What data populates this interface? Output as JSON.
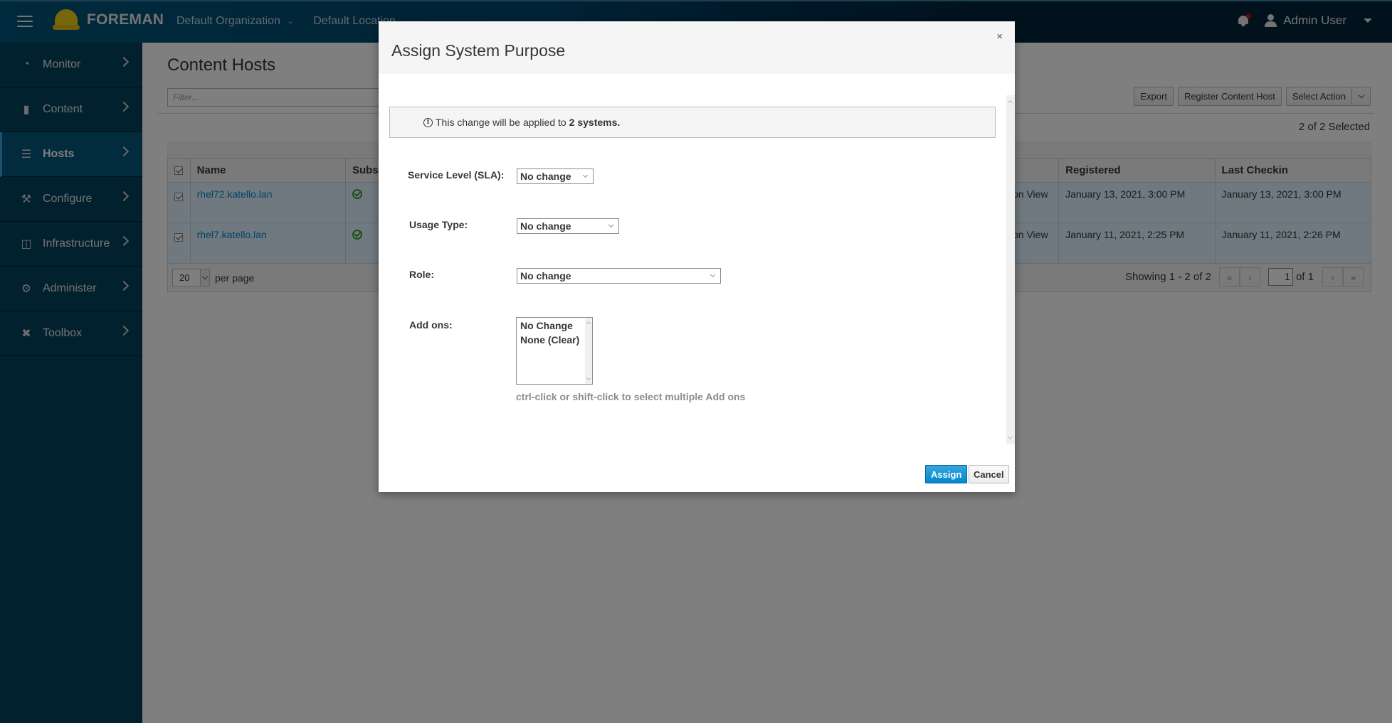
{
  "topbar": {
    "brand": "FOREMAN",
    "organization": "Default Organization",
    "location": "Default Location",
    "user": "Admin User",
    "icons": {
      "menu": "hamburger-icon",
      "logo": "helmet-icon",
      "notifications": "bell-icon",
      "user": "user-icon"
    }
  },
  "sidebar": {
    "items": [
      {
        "label": "Monitor",
        "icon": "dashboard-icon",
        "active": false
      },
      {
        "label": "Content",
        "icon": "book-icon",
        "active": false
      },
      {
        "label": "Hosts",
        "icon": "server-icon",
        "active": true
      },
      {
        "label": "Configure",
        "icon": "wrench-icon",
        "active": false
      },
      {
        "label": "Infrastructure",
        "icon": "network-icon",
        "active": false
      },
      {
        "label": "Administer",
        "icon": "gear-icon",
        "active": false
      },
      {
        "label": "Toolbox",
        "icon": "tools-icon",
        "active": false
      }
    ]
  },
  "main": {
    "title": "Content Hosts",
    "filter_placeholder": "Filter...",
    "actions": {
      "export": "Export",
      "register": "Register Content Host",
      "select_action": "Select Action"
    },
    "selected_count": "2 of 2 Selected",
    "table": {
      "columns": [
        "Name",
        "Subscri",
        "",
        "Registered",
        "Last Checkin"
      ],
      "rows": [
        {
          "name": "rhel72.katello.lan",
          "subscription_ok": true,
          "content_view_partial": "on View",
          "registered": "January 13, 2021, 3:00 PM",
          "last_checkin": "January 13, 2021, 3:00 PM",
          "checked": true
        },
        {
          "name": "rhel7.katello.lan",
          "subscription_ok": true,
          "content_view_partial": "on View",
          "registered": "January 11, 2021, 2:25 PM",
          "last_checkin": "January 11, 2021, 2:26 PM",
          "checked": true
        }
      ]
    },
    "footer": {
      "per_page_value": "20",
      "per_page_label": "per page",
      "showing": "Showing 1 - 2 of 2",
      "current_page": "1",
      "of_pages": "of 1",
      "first": "«",
      "prev": "‹",
      "next": "›",
      "last": "»"
    }
  },
  "modal": {
    "title": "Assign System Purpose",
    "close": "×",
    "info_prefix": "This change will be applied to",
    "info_count": "2 systems.",
    "fields": {
      "sla": {
        "label": "Service Level (SLA):",
        "value": "No change"
      },
      "usage": {
        "label": "Usage Type:",
        "value": "No change"
      },
      "role": {
        "label": "Role:",
        "value": "No change"
      },
      "addons": {
        "label": "Add ons:",
        "options": [
          "No Change",
          "None (Clear)"
        ],
        "help": "ctrl-click or shift-click to select multiple Add ons"
      }
    },
    "buttons": {
      "assign": "Assign",
      "cancel": "Cancel"
    }
  }
}
